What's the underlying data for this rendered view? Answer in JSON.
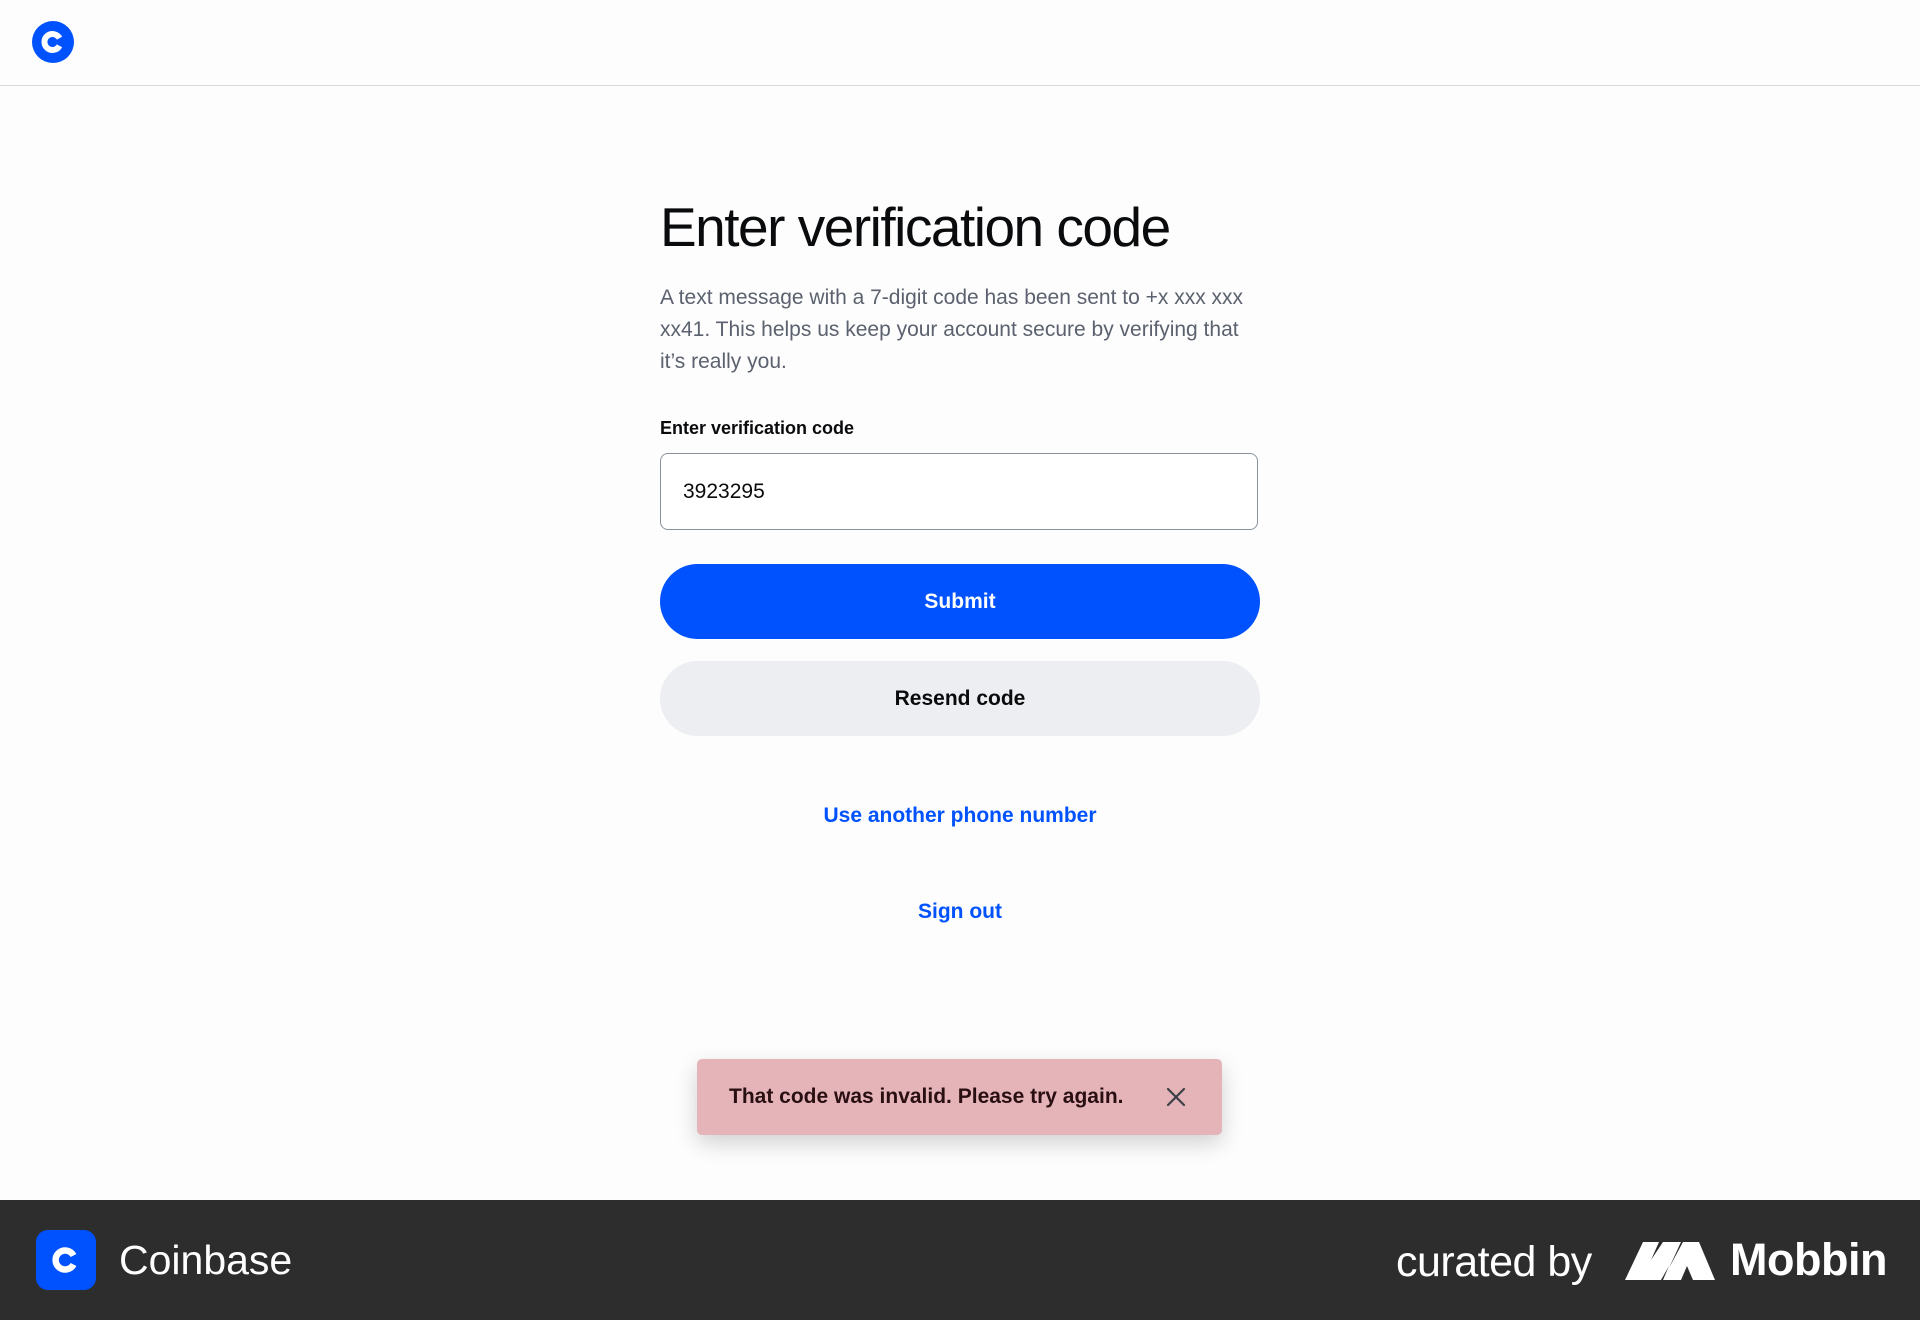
{
  "header": {
    "logo_icon": "coinbase-c-icon",
    "brand_color": "#0052ff"
  },
  "main": {
    "title": "Enter verification code",
    "description": "A text message with a 7-digit code has been sent to +x xxx xxx xx41. This helps us keep your account secure by verifying that it’s really you.",
    "field_label": "Enter verification code",
    "code_value": "3923295",
    "submit_label": "Submit",
    "resend_label": "Resend code",
    "another_phone_link": "Use another phone number",
    "sign_out_link": "Sign out"
  },
  "toast": {
    "message": "That code was invalid. Please try again.",
    "close_icon": "close-icon",
    "background": "#e4b4b9"
  },
  "footer": {
    "brand": "Coinbase",
    "curated_by": "curated by",
    "curator": "Mobbin",
    "background": "#2d2d2d"
  }
}
